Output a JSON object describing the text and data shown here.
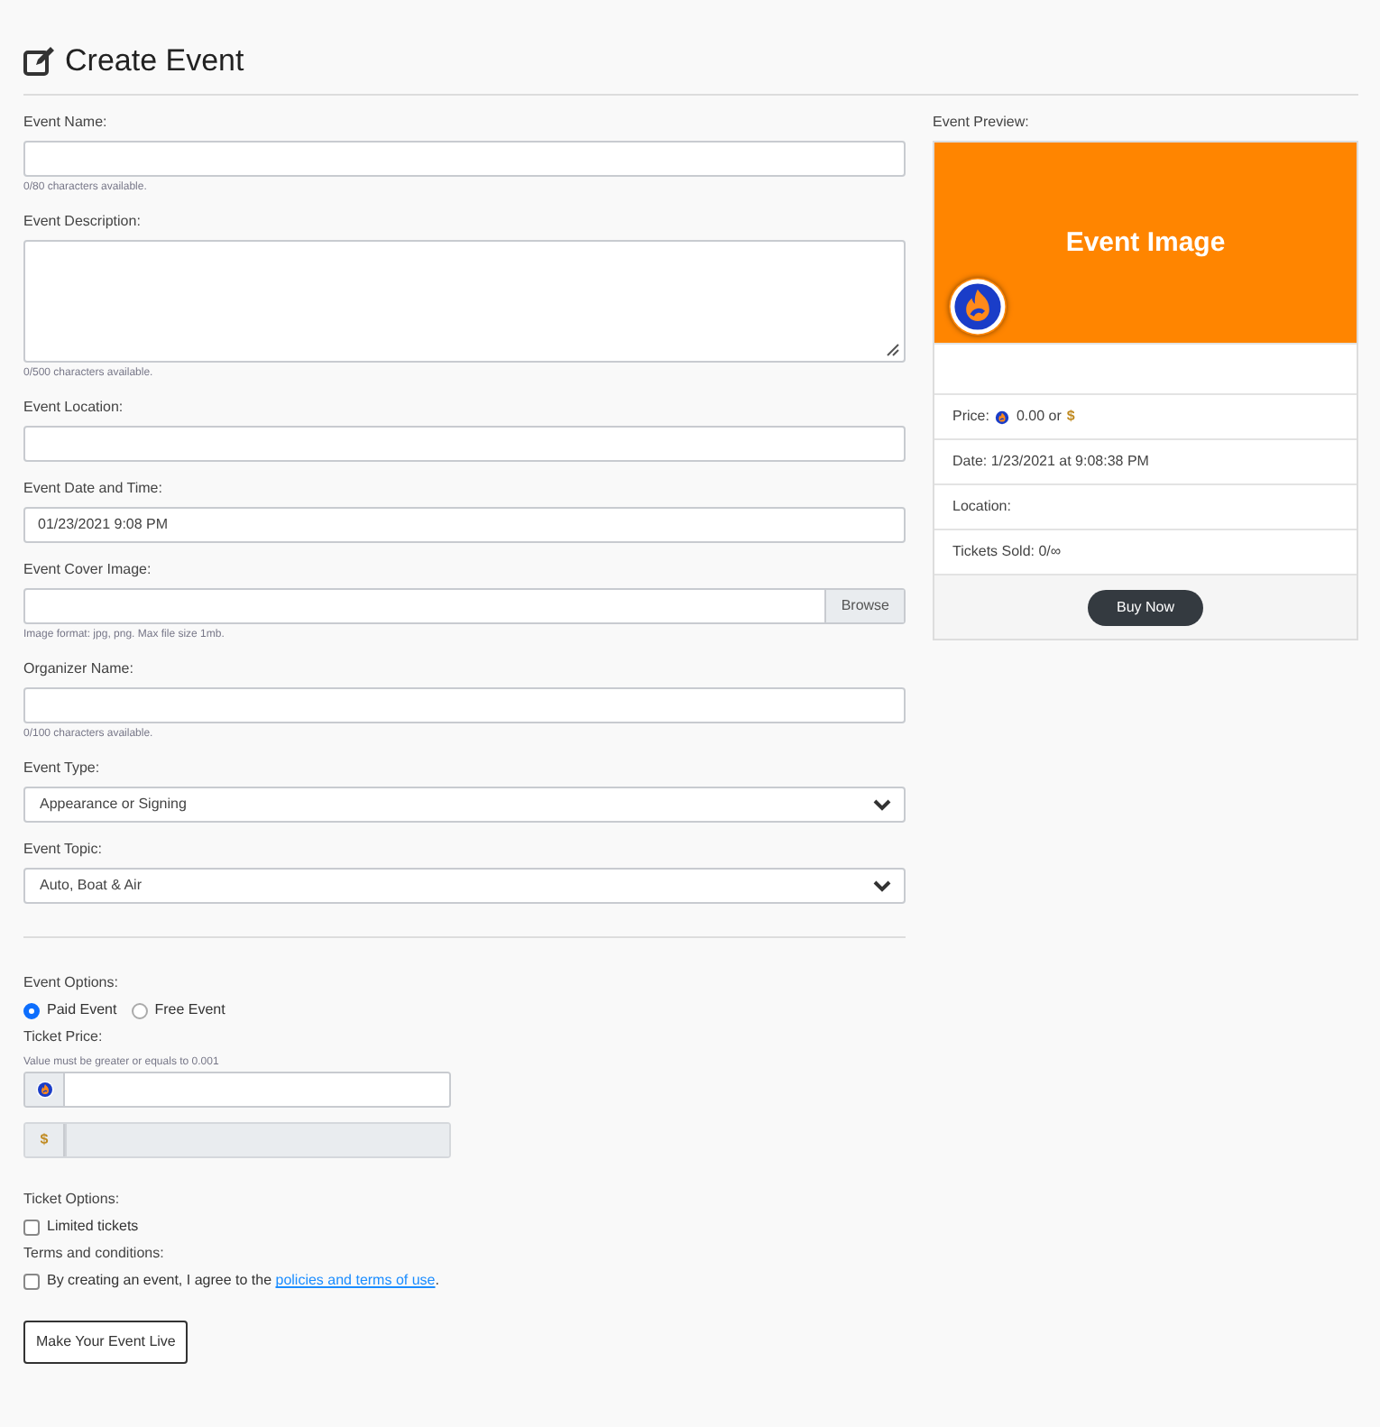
{
  "title": "Create Event",
  "fields": [
    {
      "kind": "text",
      "label": "Event Name:",
      "help": "0/80 characters available."
    },
    {
      "kind": "textarea",
      "label": "Event Description:",
      "help": "0/500 characters available."
    },
    {
      "kind": "text",
      "label": "Event Location:"
    },
    {
      "kind": "text",
      "label": "Event Date and Time:",
      "value": "01/23/2021 9:08 PM"
    },
    {
      "kind": "file",
      "label": "Event Cover Image:",
      "button": "Browse",
      "help": "Image format: jpg, png. Max file size 1mb."
    },
    {
      "kind": "text",
      "label": "Organizer Name:",
      "help": "0/100 characters available."
    },
    {
      "kind": "select",
      "label": "Event Type:",
      "value": "Appearance or Signing"
    },
    {
      "kind": "select",
      "label": "Event Topic:",
      "value": "Auto, Boat & Air"
    }
  ],
  "options": {
    "label": "Event Options:",
    "radios": [
      {
        "label": "Paid Event",
        "selected": true
      },
      {
        "label": "Free Event",
        "selected": false
      }
    ]
  },
  "ticket_price": {
    "label": "Ticket Price:",
    "hint": "Value must be greater or equals to 0.001",
    "inputs": [
      {
        "kind": "coin",
        "disabled": false
      },
      {
        "kind": "dollar",
        "symbol": "$",
        "disabled": true
      }
    ]
  },
  "ticket_options": {
    "label": "Ticket Options:",
    "checkbox": {
      "label": "Limited tickets",
      "checked": false
    }
  },
  "terms": {
    "label": "Terms and conditions:",
    "checkbox": {
      "text": "By creating an event, I agree to the ",
      "link": "policies and terms of use",
      "after": ".",
      "checked": false
    }
  },
  "submit": "Make Your Event Live",
  "preview": {
    "label": "Event Preview:",
    "image_text": "Event Image",
    "rows": [
      {
        "kind": "blank"
      },
      {
        "kind": "price",
        "label": "Price:",
        "amount": "0.00 or",
        "symbol": "$"
      },
      {
        "kind": "text",
        "text": "Date: 1/23/2021 at 9:08:38 PM"
      },
      {
        "kind": "text",
        "text": "Location:"
      },
      {
        "kind": "text",
        "text": "Tickets Sold: 0/∞"
      }
    ],
    "button": "Buy Now"
  }
}
